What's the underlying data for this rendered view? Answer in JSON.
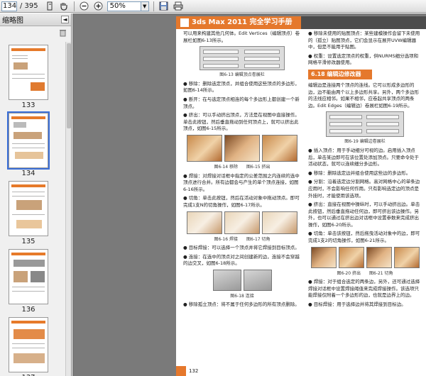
{
  "toolbar": {
    "page_current": "134",
    "page_total": "/ 395",
    "zoom": "50%",
    "icons": [
      "select-text-icon",
      "hand-tool-icon",
      "zoom-out-icon",
      "zoom-in-icon",
      "save-icon",
      "print-icon"
    ]
  },
  "sidebar": {
    "title": "缩略图",
    "thumbnails": [
      {
        "label": "133"
      },
      {
        "label": "134",
        "selected": true
      },
      {
        "label": "135"
      },
      {
        "label": "136"
      },
      {
        "label": "137"
      }
    ]
  },
  "page": {
    "header_title": "3ds Max 2011 完全学习手册",
    "page_number": "132",
    "section_title": "6.18 编辑边修改器",
    "left_paras": [
      "可以用来构建其他几何体。Edit Vertices（编辑顶点）卷展栏如图6-13所示。",
      "● 移除：删除选定顶点，并组合使用这些顶点的多边形，如图6-14所示。",
      "● 断开：在与选定顶点相连的每个多边形上都创建一个新顶点。",
      "● 挤出：可以手动挤出顶点，方法是在视图中直接操作。单击此按钮，然后垂直拖动到任何顶点上，就可以挤出此顶点，如图6-15所示。",
      "● 焊接：对焊接对话框中指定的公差范围之内连续的选中顶点进行合并。所有边都会与产生的单个顶点连接，如图6-16所示。",
      "● 切角：单击此按钮，然后在活动对象中拖动顶点。即可完成1支N的切角操作，如图6-17所示。",
      "● 目标焊接：可以选择一个顶点并将它焊接到目标顶点。",
      "● 连接：在选中的顶点对之间创建新的边，连接不会穿越的边交叉，如图6-18所示。",
      "● 移除孤立顶点：将不属于任何多边形的所有顶点删除。"
    ],
    "right_paras": [
      "● 移除未使用的贴图顶点：某些建模操作会留下未使用的（孤立）贴图顶点，它们会显示在展开UVW编辑器中，但是不能用于贴图。",
      "● 权重：设置选定顶点的权重，供NURMS细分选项和网格平滑修改器使用。",
      "编辑边是连接两个顶点的连线。它可以形成多边形的边，边不能由两个以上多边形共享。另外，两个多边形的法线应相邻。如果不相邻，应卷起共享顶点的两条边。Edit Edges（编辑边）卷展栏如图6-19所示。",
      "● 插入顶点：用于手动细分可视的边。启用插入顶点后，单击某边即可在该位置处添加顶点。只要命令处于活动状态，就可以连续细分多边形。",
      "● 移除：删除选定边并组合使用这些边的多边形。",
      "● 分割：沿着选定边分割网格。高对网格中心的单条边应用时，不会影响任何作用。只有影响选定边的顶点是外挂时，才能使用该选项。",
      "● 挤出：直接在视图中操纵时，可以手动挤出边。单击此按钮，然后垂直拖动任何边，即可挤出该边操作。另外，也可以通过在挤出边对话框中设置参数来完成挤出操作，如图6-20所示。",
      "● 切角：单击该按钮，然后拖曳活动对象中的边，即可完成1支2的切角操作，如图6-21所示。",
      "● 焊接：对于组合选定的两条边，另外，还可通过选择焊接对话框中设置焊接阈值来完成焊接操作。该选项只能焊接仅附着一个多边形的边，也就是边界上的边。",
      "● 目标焊接：用于选择边并将其焊接到目标边。"
    ],
    "captions": {
      "f13": "图6-13  编辑顶点卷展栏",
      "f14": "图6-14  移除",
      "f15": "图6-15  挤出",
      "f16": "图6-16  焊接",
      "f17": "图6-17  切角",
      "f18": "图6-18  连接",
      "f19": "图6-19  编辑边卷展栏",
      "f20": "图6-20  挤出",
      "f21": "图6-21  切角"
    }
  }
}
